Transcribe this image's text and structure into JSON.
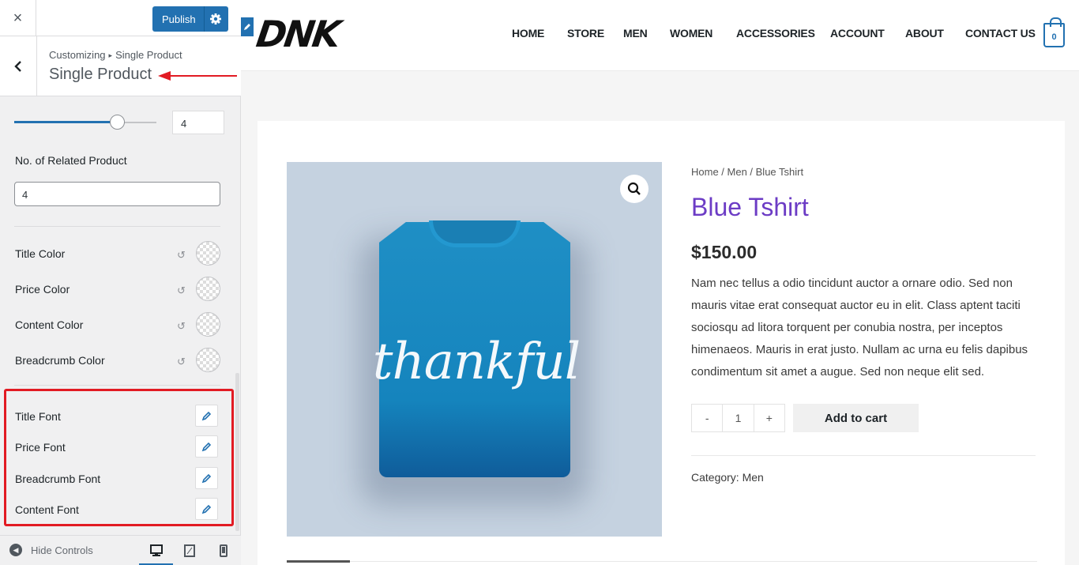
{
  "customizer": {
    "close_label": "×",
    "publish_label": "Publish",
    "breadcrumb": {
      "root": "Customizing",
      "separator": "▸",
      "current": "Single Product"
    },
    "section_title": "Single Product",
    "slider": {
      "value": "4",
      "fraction": 0.72
    },
    "related_label": "No. of Related Product",
    "related_value": "4",
    "colors": [
      {
        "label": "Title Color"
      },
      {
        "label": "Price Color"
      },
      {
        "label": "Content Color"
      },
      {
        "label": "Breadcrumb Color"
      }
    ],
    "fonts": [
      {
        "label": "Title Font"
      },
      {
        "label": "Price Font"
      },
      {
        "label": "Breadcrumb Font"
      },
      {
        "label": "Content Font"
      }
    ],
    "footer": {
      "hide_controls": "Hide Controls"
    },
    "highlight_color": "#e21b23",
    "accent": "#2271b1"
  },
  "site": {
    "logo": "DNK",
    "nav": [
      "HOME",
      "STORE",
      "MEN",
      "WOMEN",
      "ACCESSORIES",
      "ACCOUNT",
      "ABOUT",
      "CONTACT US"
    ],
    "cart_count": "0",
    "product": {
      "breadcrumb": "Home / Men / Blue Tshirt",
      "title": "Blue Tshirt",
      "price": "$150.00",
      "description": "Nam nec tellus a odio tincidunt auctor a ornare odio. Sed non mauris vitae erat consequat auctor eu in elit. Class aptent taciti sociosqu ad litora torquent per conubia nostra, per inceptos himenaeos. Mauris in erat justo. Nullam ac urna eu felis dapibus condimentum sit amet a augue. Sed non neque elit sed.",
      "shirt_text": "thankful",
      "qty_minus": "-",
      "qty_value": "1",
      "qty_plus": "+",
      "add_to_cart": "Add to cart",
      "category": "Category: Men",
      "title_color": "#6c3cc5"
    }
  }
}
